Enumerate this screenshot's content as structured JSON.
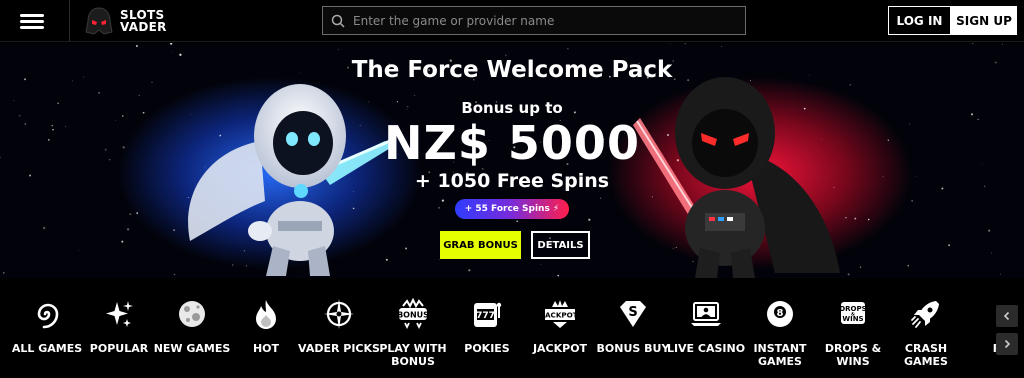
{
  "header": {
    "menu_icon": "hamburger-icon",
    "logo_line1": "SLOTS",
    "logo_line2": "VADER",
    "search_placeholder": "Enter the game or provider name",
    "login_label": "LOG IN",
    "signup_label": "SIGN UP"
  },
  "hero": {
    "title": "The Force Welcome Pack",
    "bonus_line": "Bonus up to",
    "amount": "NZ$ 5000",
    "spins": "+ 1050 Free Spins",
    "pill": "+ 55 Force Spins ⚡",
    "grab_label": "GRAB BONUS",
    "details_label": "DETAILS",
    "accent_colors": {
      "left_glow": "#2a6bff",
      "right_glow": "#ff1e3c",
      "grab_button": "#e6ff00"
    }
  },
  "categories": [
    {
      "label": "ALL GAMES",
      "icon": "spiral-galaxy-icon"
    },
    {
      "label": "POPULAR",
      "icon": "sparkle-icon"
    },
    {
      "label": "NEW GAMES",
      "icon": "planet-icon"
    },
    {
      "label": "HOT",
      "icon": "flame-icon"
    },
    {
      "label": "VADER PICKS",
      "icon": "crosshair-icon"
    },
    {
      "label": "PLAY WITH BONUS",
      "icon": "bonus-badge-icon",
      "badge": "BONUS"
    },
    {
      "label": "POKIES",
      "icon": "slot-machine-icon",
      "badge": "777"
    },
    {
      "label": "JACKPOT",
      "icon": "jackpot-crown-icon",
      "badge": "JACKPOT"
    },
    {
      "label": "BONUS BUY",
      "icon": "diamond-s-icon",
      "badge": "S"
    },
    {
      "label": "LIVE CASINO",
      "icon": "live-laptop-icon"
    },
    {
      "label": "INSTANT GAMES",
      "icon": "eight-ball-icon",
      "badge": "8"
    },
    {
      "label": "DROPS & WINS",
      "icon": "drops-wins-icon",
      "badge": "DROPS & WINS"
    },
    {
      "label": "CRASH GAMES",
      "icon": "crash-rocket-icon"
    },
    {
      "label": "RI",
      "icon": ""
    }
  ],
  "nav_arrows": {
    "prev_icon": "chevron-left-icon",
    "next_icon": "chevron-right-icon"
  }
}
